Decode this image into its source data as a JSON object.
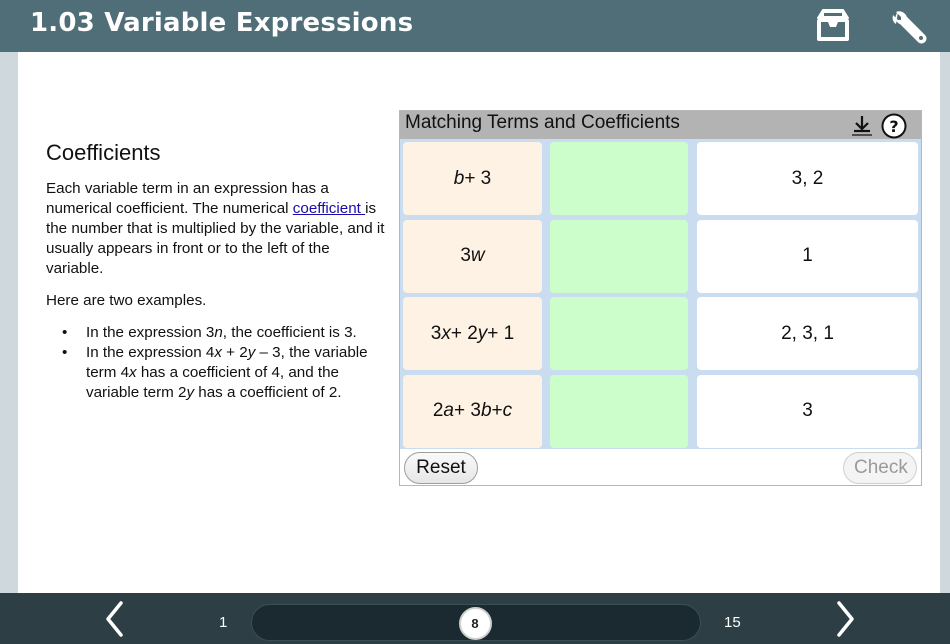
{
  "header": {
    "title": "1.03 Variable Expressions",
    "icons": [
      "inbox-icon",
      "wrench-icon"
    ]
  },
  "lesson": {
    "heading": "Coefficients",
    "para1_pre": "Each variable term in an expression has a numerical coefficient. The numerical ",
    "para1_link": "coefficient ",
    "para1_post": "is the number that is multiplied by the variable, and it usually appears in front or to the left of the variable.",
    "para2": "Here are two examples.",
    "bullet1": {
      "pre": "In the expression 3",
      "var": "n",
      "post": ", the coefficient is 3."
    },
    "bullet2": {
      "t1": "In the expression 4",
      "v1": "x",
      "t2": " + 2",
      "v2": "y",
      "t3": " – 3, the variable term 4",
      "v3": "x",
      "t4": " has a coefficient of 4, and the variable term 2",
      "v4": "y",
      "t5": " has a coefficient of 2."
    }
  },
  "widget": {
    "title": "Matching Terms and Coefficients",
    "icons": [
      "download-icon",
      "help-icon"
    ],
    "rows": [
      {
        "term_parts": [
          {
            "v": "b",
            "i": true
          },
          {
            "v": " + 3",
            "i": false
          }
        ],
        "answer": "",
        "coefficient": "3, 2"
      },
      {
        "term_parts": [
          {
            "v": "3",
            "i": false
          },
          {
            "v": "w",
            "i": true
          }
        ],
        "answer": "",
        "coefficient": "1"
      },
      {
        "term_parts": [
          {
            "v": "3",
            "i": false
          },
          {
            "v": "x",
            "i": true
          },
          {
            "v": " + 2",
            "i": false
          },
          {
            "v": "y",
            "i": true
          },
          {
            "v": " + 1",
            "i": false
          }
        ],
        "answer": "",
        "coefficient": "2, 3, 1"
      },
      {
        "term_parts": [
          {
            "v": "2",
            "i": false
          },
          {
            "v": "a",
            "i": true
          },
          {
            "v": " + 3",
            "i": false
          },
          {
            "v": "b",
            "i": true
          },
          {
            "v": " + ",
            "i": false
          },
          {
            "v": "c",
            "i": true
          }
        ],
        "answer": "",
        "coefficient": "3"
      }
    ],
    "reset_label": "Reset",
    "check_label": "Check"
  },
  "footer": {
    "first_page": "1",
    "current_page": "8",
    "last_page": "15",
    "current_fraction": 0.5,
    "icons": [
      "chevron-left-icon",
      "chevron-right-icon"
    ]
  },
  "colors": {
    "header_bg": "#4f6e78",
    "footer_bg": "#2d3e45",
    "term_bg": "#fdf2e3",
    "slot_bg": "#ccfecc",
    "grid_bg": "#cadcf0",
    "link": "#1a0dab"
  }
}
